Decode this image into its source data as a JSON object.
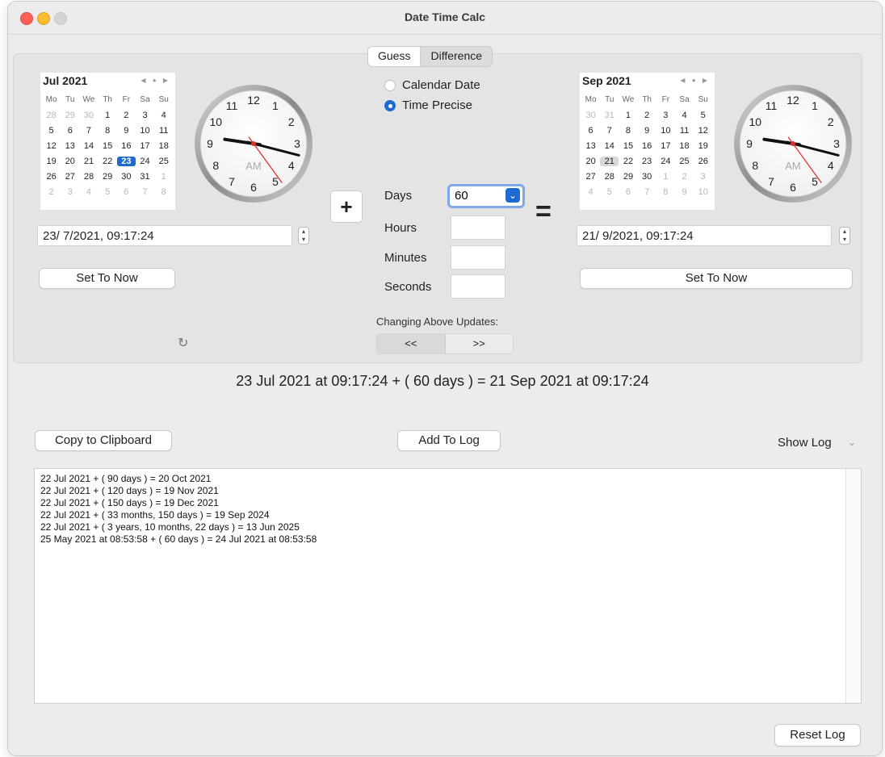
{
  "window": {
    "title": "Date Time Calc"
  },
  "modes": {
    "guess": "Guess",
    "difference": "Difference"
  },
  "left": {
    "month_title": "Jul 2021",
    "nav": "◀ ● ▶",
    "dow": [
      "Mo",
      "Tu",
      "We",
      "Th",
      "Fr",
      "Sa",
      "Su"
    ],
    "weeks": [
      [
        {
          "d": "28",
          "dim": true
        },
        {
          "d": "29",
          "dim": true
        },
        {
          "d": "30",
          "dim": true
        },
        {
          "d": "1"
        },
        {
          "d": "2"
        },
        {
          "d": "3"
        },
        {
          "d": "4"
        }
      ],
      [
        {
          "d": "5"
        },
        {
          "d": "6"
        },
        {
          "d": "7"
        },
        {
          "d": "8"
        },
        {
          "d": "9"
        },
        {
          "d": "10"
        },
        {
          "d": "11"
        }
      ],
      [
        {
          "d": "12"
        },
        {
          "d": "13"
        },
        {
          "d": "14"
        },
        {
          "d": "15"
        },
        {
          "d": "16"
        },
        {
          "d": "17"
        },
        {
          "d": "18"
        }
      ],
      [
        {
          "d": "19"
        },
        {
          "d": "20"
        },
        {
          "d": "21"
        },
        {
          "d": "22"
        },
        {
          "d": "23",
          "sel": "blue"
        },
        {
          "d": "24"
        },
        {
          "d": "25"
        }
      ],
      [
        {
          "d": "26"
        },
        {
          "d": "27"
        },
        {
          "d": "28"
        },
        {
          "d": "29"
        },
        {
          "d": "30"
        },
        {
          "d": "31"
        },
        {
          "d": "1",
          "dim": true
        }
      ],
      [
        {
          "d": "2",
          "dim": true
        },
        {
          "d": "3",
          "dim": true
        },
        {
          "d": "4",
          "dim": true
        },
        {
          "d": "5",
          "dim": true
        },
        {
          "d": "6",
          "dim": true
        },
        {
          "d": "7",
          "dim": true
        },
        {
          "d": "8",
          "dim": true
        }
      ]
    ],
    "clock": {
      "ampm": "AM",
      "hour": 9,
      "minute": 17,
      "second": 24
    },
    "datetime": "23/ 7/2021, 09:17:24",
    "set_now": "Set To Now",
    "refresh_icon": "↻"
  },
  "right": {
    "month_title": "Sep 2021",
    "nav": "◀ ● ▶",
    "dow": [
      "Mo",
      "Tu",
      "We",
      "Th",
      "Fr",
      "Sa",
      "Su"
    ],
    "weeks": [
      [
        {
          "d": "30",
          "dim": true
        },
        {
          "d": "31",
          "dim": true
        },
        {
          "d": "1"
        },
        {
          "d": "2"
        },
        {
          "d": "3"
        },
        {
          "d": "4"
        },
        {
          "d": "5"
        }
      ],
      [
        {
          "d": "6"
        },
        {
          "d": "7"
        },
        {
          "d": "8"
        },
        {
          "d": "9"
        },
        {
          "d": "10"
        },
        {
          "d": "11"
        },
        {
          "d": "12"
        }
      ],
      [
        {
          "d": "13"
        },
        {
          "d": "14"
        },
        {
          "d": "15"
        },
        {
          "d": "16"
        },
        {
          "d": "17"
        },
        {
          "d": "18"
        },
        {
          "d": "19"
        }
      ],
      [
        {
          "d": "20"
        },
        {
          "d": "21",
          "sel": "gray"
        },
        {
          "d": "22"
        },
        {
          "d": "23"
        },
        {
          "d": "24"
        },
        {
          "d": "25"
        },
        {
          "d": "26"
        }
      ],
      [
        {
          "d": "27"
        },
        {
          "d": "28"
        },
        {
          "d": "29"
        },
        {
          "d": "30"
        },
        {
          "d": "1",
          "dim": true
        },
        {
          "d": "2",
          "dim": true
        },
        {
          "d": "3",
          "dim": true
        }
      ],
      [
        {
          "d": "4",
          "dim": true
        },
        {
          "d": "5",
          "dim": true
        },
        {
          "d": "6",
          "dim": true
        },
        {
          "d": "7",
          "dim": true
        },
        {
          "d": "8",
          "dim": true
        },
        {
          "d": "9",
          "dim": true
        },
        {
          "d": "10",
          "dim": true
        }
      ]
    ],
    "clock": {
      "ampm": "AM",
      "hour": 9,
      "minute": 17,
      "second": 24
    },
    "datetime": "21/ 9/2021, 09:17:24",
    "set_now": "Set To Now"
  },
  "middle": {
    "radio_calendar": "Calendar Date",
    "radio_time": "Time Precise",
    "plus": "+",
    "equals": "=",
    "days_label": "Days",
    "days_value": "60",
    "hours_label": "Hours",
    "minutes_label": "Minutes",
    "seconds_label": "Seconds",
    "changing_label": "Changing Above Updates:",
    "prev": "<<",
    "next": ">>"
  },
  "result_text": "23 Jul 2021 at 09:17:24 + ( 60 days ) = 21 Sep 2021 at 09:17:24",
  "actions": {
    "copy": "Copy to Clipboard",
    "add_log": "Add To Log",
    "show_log": "Show Log",
    "reset_log": "Reset Log"
  },
  "log_lines": [
    "22 Jul 2021 + ( 90 days ) = 20 Oct 2021",
    "22 Jul 2021 + ( 120 days ) = 19 Nov 2021",
    "22 Jul 2021 + ( 150 days ) = 19 Dec 2021",
    "22 Jul 2021 + ( 33 months, 150 days ) = 19 Sep 2024",
    "22 Jul 2021 + ( 3 years, 10 months, 22 days ) = 13 Jun 2025",
    "25 May 2021 at 08:53:58 + ( 60 days ) = 24 Jul 2021 at 08:53:58"
  ]
}
